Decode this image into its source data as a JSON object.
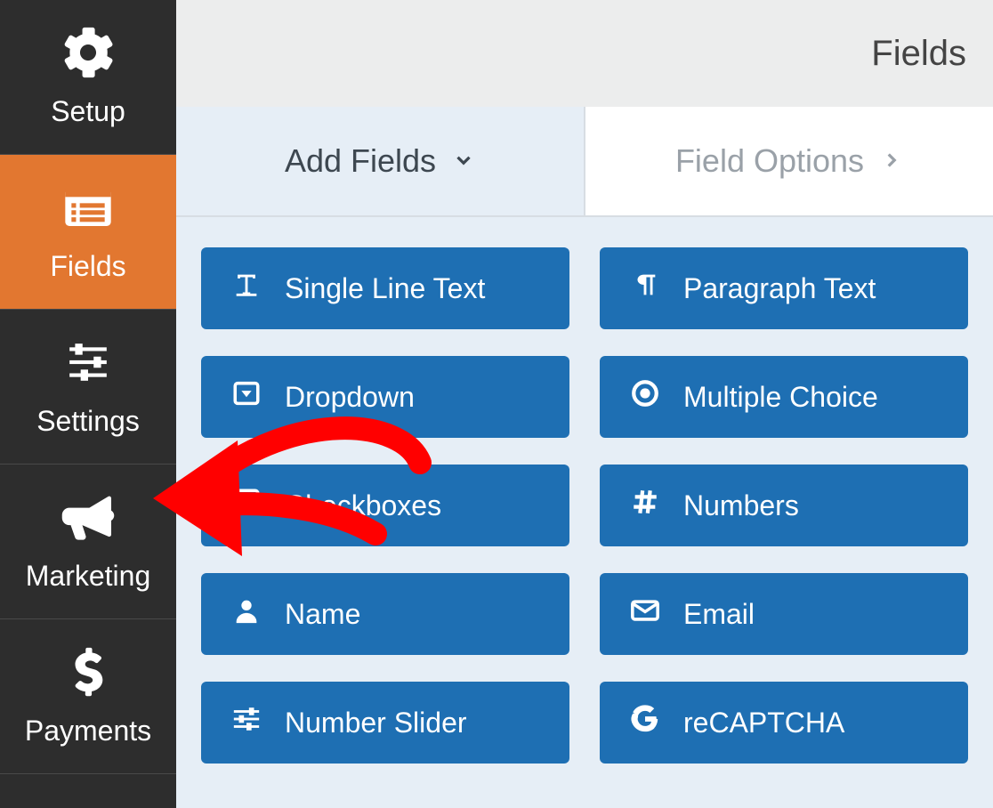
{
  "header": {
    "title": "Fields"
  },
  "sidebar": {
    "items": [
      {
        "label": "Setup",
        "icon": "gear",
        "active": false
      },
      {
        "label": "Fields",
        "icon": "list",
        "active": true
      },
      {
        "label": "Settings",
        "icon": "sliders",
        "active": false
      },
      {
        "label": "Marketing",
        "icon": "bullhorn",
        "active": false
      },
      {
        "label": "Payments",
        "icon": "dollar",
        "active": false
      }
    ]
  },
  "tabs": [
    {
      "label": "Add Fields",
      "active": true,
      "chevron": "down"
    },
    {
      "label": "Field Options",
      "active": false,
      "chevron": "right"
    }
  ],
  "field_buttons": [
    {
      "label": "Single Line Text",
      "icon": "text"
    },
    {
      "label": "Paragraph Text",
      "icon": "pilcrow"
    },
    {
      "label": "Dropdown",
      "icon": "dropdown"
    },
    {
      "label": "Multiple Choice",
      "icon": "radio"
    },
    {
      "label": "Checkboxes",
      "icon": "checkbox"
    },
    {
      "label": "Numbers",
      "icon": "hash"
    },
    {
      "label": "Name",
      "icon": "user"
    },
    {
      "label": "Email",
      "icon": "envelope"
    },
    {
      "label": "Number Slider",
      "icon": "sliders-h"
    },
    {
      "label": "reCAPTCHA",
      "icon": "google"
    }
  ],
  "colors": {
    "accent": "#e27730",
    "button": "#1e6fb3",
    "sidebar": "#2d2d2d"
  }
}
